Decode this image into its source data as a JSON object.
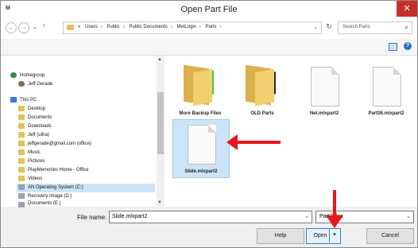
{
  "window": {
    "title": "Open Part File",
    "app_icon": "M",
    "close_glyph": "✕"
  },
  "nav": {
    "back": "←",
    "forward": "→",
    "up": "↑",
    "breadcrumb": [
      "«",
      "Users",
      "Public",
      "Public Documents",
      "MetLogix",
      "Parts"
    ],
    "search_placeholder": "Search Parts",
    "refresh": "↻"
  },
  "sidebar": {
    "items": [
      {
        "label": "Homegroup",
        "icon": "homegroup-icon"
      },
      {
        "label": "Jeff Gerade",
        "icon": "user-icon"
      },
      {
        "label": "This PC",
        "icon": "pc-icon"
      },
      {
        "label": "Desktop",
        "icon": "folder-icon"
      },
      {
        "label": "Documents",
        "icon": "folder-icon"
      },
      {
        "label": "Downloads",
        "icon": "folder-icon"
      },
      {
        "label": "Jeff (ultra)",
        "icon": "folder-icon"
      },
      {
        "label": "jeffgerade@gmail.com (office)",
        "icon": "folder-icon"
      },
      {
        "label": "Music",
        "icon": "folder-icon"
      },
      {
        "label": "Pictures",
        "icon": "folder-icon"
      },
      {
        "label": "PlayMemories Home - Office",
        "icon": "folder-icon"
      },
      {
        "label": "Videos",
        "icon": "folder-icon"
      },
      {
        "label": "AN Operating System (C:)",
        "icon": "drive-icon"
      },
      {
        "label": "Recovery Image (D:)",
        "icon": "drive-icon"
      },
      {
        "label": "Documents (E:)",
        "icon": "drive-icon"
      }
    ]
  },
  "files": [
    {
      "name": "More Backup Files",
      "type": "folder",
      "preview": "green"
    },
    {
      "name": "OLD Parts",
      "type": "folder",
      "preview": "dark"
    },
    {
      "name": "Net.mlxpart2",
      "type": "document"
    },
    {
      "name": "Part26.mlxpart2",
      "type": "document"
    },
    {
      "name": "Slide.mlxpart2",
      "type": "document",
      "selected": true
    }
  ],
  "footer": {
    "file_name_label": "File name:",
    "file_name_value": "Slide.mlxpart2",
    "file_type_value": "Part Files",
    "help_label": "Help",
    "open_label": "Open",
    "cancel_label": "Cancel"
  },
  "colors": {
    "annotation_red": "#e8161b",
    "selection": "#cce4f7",
    "close_red": "#c7302a"
  }
}
